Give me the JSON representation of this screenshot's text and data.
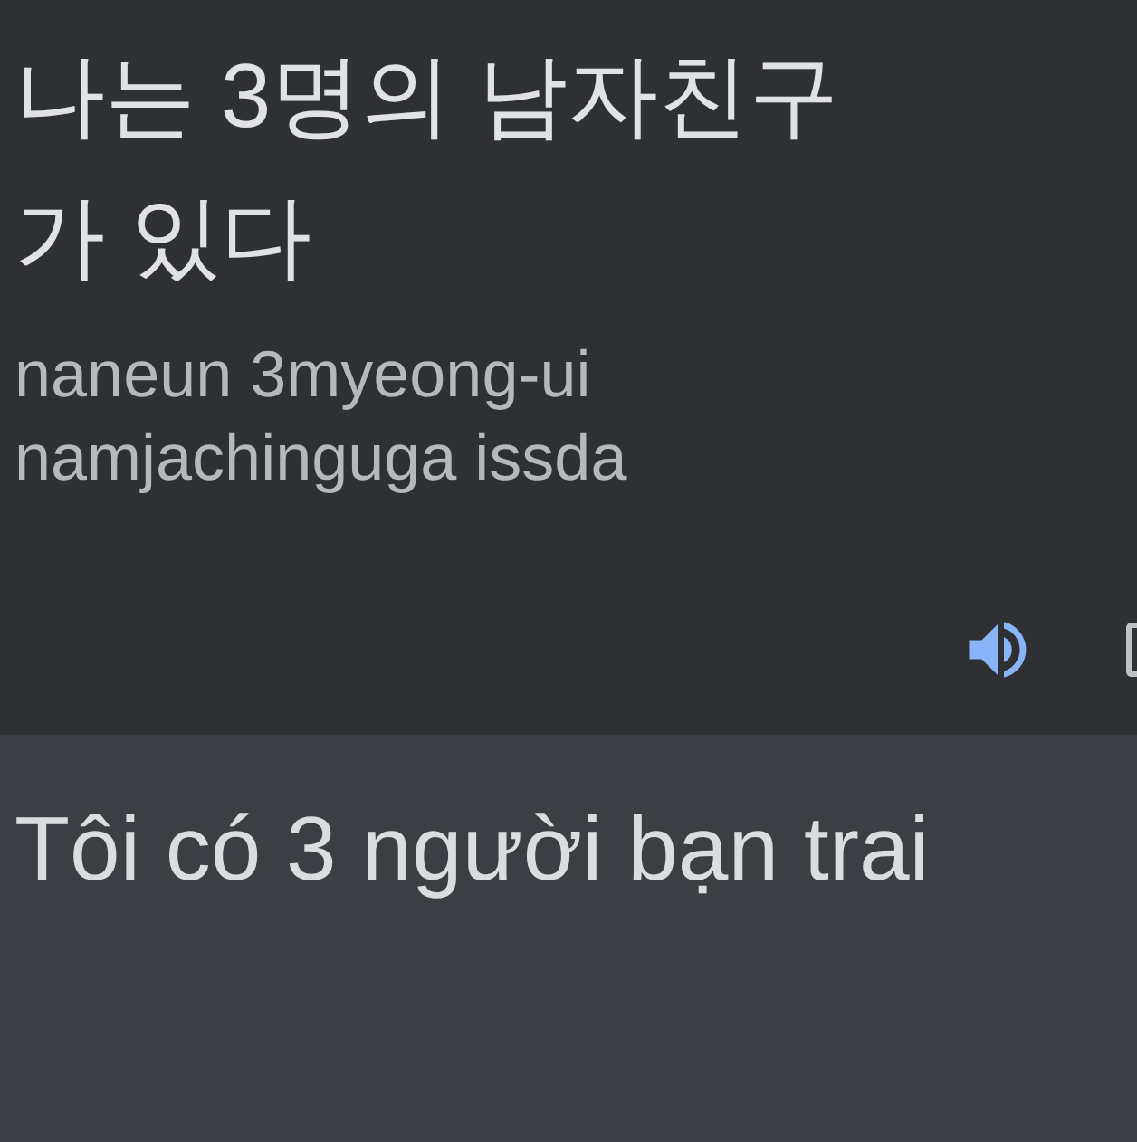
{
  "source": {
    "text_lines": [
      "나는 3명의 남자친구",
      "가 있다"
    ],
    "romanization_lines": [
      "naneun 3myeong-ui",
      "namjachinguga issda"
    ]
  },
  "translation": {
    "text": "Tôi có 3 người bạn trai"
  }
}
